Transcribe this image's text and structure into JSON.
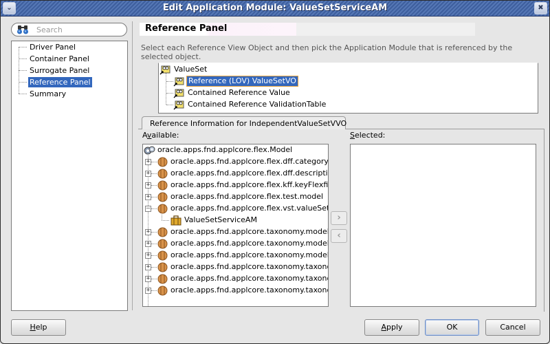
{
  "window": {
    "title": "Edit Application Module: ValueSetServiceAM",
    "menu_icon": "chevron-down-icon",
    "close_icon": "close-icon"
  },
  "search": {
    "placeholder": "Search",
    "icon": "binoculars-icon"
  },
  "nav": {
    "items": [
      {
        "label": "Driver Panel",
        "selected": false
      },
      {
        "label": "Container Panel",
        "selected": false
      },
      {
        "label": "Surrogate Panel",
        "selected": false
      },
      {
        "label": "Reference Panel",
        "selected": true
      },
      {
        "label": "Summary",
        "selected": false
      }
    ]
  },
  "panel": {
    "title": "Reference Panel",
    "instructions": "Select each Reference View Object and then pick the Application Module that is referenced by the selected object."
  },
  "vo_tree": {
    "root": "ValueSet",
    "children": [
      {
        "label": "Reference (LOV) ValueSetVO",
        "selected": true
      },
      {
        "label": "Contained Reference Value",
        "selected": false
      },
      {
        "label": "Contained Reference ValidationTable",
        "selected": false
      }
    ]
  },
  "tab": {
    "label": "Reference Information for IndependentValueSetVVO"
  },
  "available": {
    "label_prefix": "A",
    "label_mnemonic": "v",
    "label_suffix": "ailable:",
    "root": "oracle.apps.fnd.applcore.flex.Model",
    "packages": [
      {
        "label": "oracle.apps.fnd.applcore.flex.dff.category.ca",
        "expanded": false
      },
      {
        "label": "oracle.apps.fnd.applcore.flex.dff.descriptive",
        "expanded": false
      },
      {
        "label": "oracle.apps.fnd.applcore.flex.kff.keyFlexfield",
        "expanded": false
      },
      {
        "label": "oracle.apps.fnd.applcore.flex.test.model",
        "expanded": false
      },
      {
        "label": "oracle.apps.fnd.applcore.flex.vst.valueSetS",
        "expanded": true,
        "children": [
          "ValueSetServiceAM"
        ]
      },
      {
        "label": "oracle.apps.fnd.applcore.taxonomy.model.",
        "expanded": false
      },
      {
        "label": "oracle.apps.fnd.applcore.taxonomy.model.",
        "expanded": false
      },
      {
        "label": "oracle.apps.fnd.applcore.taxonomy.model.",
        "expanded": false
      },
      {
        "label": "oracle.apps.fnd.applcore.taxonomy.taxono",
        "expanded": false
      },
      {
        "label": "oracle.apps.fnd.applcore.taxonomy.taxono",
        "expanded": false
      },
      {
        "label": "oracle.apps.fnd.applcore.taxonomy.taxono",
        "expanded": false
      }
    ]
  },
  "selected": {
    "label_mnemonic": "S",
    "label_suffix": "elected:",
    "items": []
  },
  "shuttle": {
    "add": "›",
    "remove": "‹"
  },
  "buttons": {
    "help_mnemonic": "H",
    "help_suffix": "elp",
    "apply_mnemonic": "A",
    "apply_suffix": "pply",
    "ok": "OK",
    "cancel": "Cancel"
  },
  "colors": {
    "selection": "#3367bd",
    "focus_border": "#e8a33c",
    "titlebar": "#4a6aa8"
  }
}
